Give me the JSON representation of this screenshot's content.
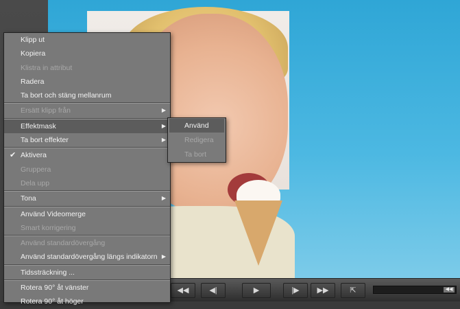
{
  "context_menu": {
    "items": [
      {
        "label": "Klipp ut",
        "enabled": true
      },
      {
        "label": "Kopiera",
        "enabled": true
      },
      {
        "label": "Klistra in attribut",
        "enabled": false
      },
      {
        "label": "Radera",
        "enabled": true
      },
      {
        "label": "Ta bort och stäng mellanrum",
        "enabled": true
      },
      {
        "label": "Ersätt klipp från",
        "enabled": false,
        "submenu": true
      },
      {
        "label": "Effektmask",
        "enabled": true,
        "submenu": true,
        "selected": true
      },
      {
        "label": "Ta bort effekter",
        "enabled": true,
        "submenu": true
      },
      {
        "label": "Aktivera",
        "enabled": true,
        "checked": true
      },
      {
        "label": "Gruppera",
        "enabled": false
      },
      {
        "label": "Dela upp",
        "enabled": false
      },
      {
        "label": "Tona",
        "enabled": true,
        "submenu": true
      },
      {
        "label": "Använd Videomerge",
        "enabled": true
      },
      {
        "label": "Smart korrigering",
        "enabled": false
      },
      {
        "label": "Använd standardövergång",
        "enabled": false
      },
      {
        "label": "Använd standardövergång längs indikatorn",
        "enabled": true,
        "submenu": true
      },
      {
        "label": "Tidssträckning ...",
        "enabled": true
      },
      {
        "label": "Rotera 90° åt vänster",
        "enabled": true
      },
      {
        "label": "Rotera 90° åt höger",
        "enabled": true
      }
    ],
    "arrow_glyph": "▶",
    "check_glyph": "✔"
  },
  "submenu": {
    "items": [
      {
        "label": "Använd",
        "enabled": true,
        "selected": true
      },
      {
        "label": "Redigera",
        "enabled": false
      },
      {
        "label": "Ta bort",
        "enabled": false
      }
    ]
  },
  "transport": {
    "rewind_glyph": "◀◀",
    "step_back_glyph": "◀|",
    "play_glyph": "▶",
    "step_fwd_glyph": "|▶",
    "fast_fwd_glyph": "▶▶",
    "export_glyph": "⇱",
    "scrub_thumb_glyph": "◀◀"
  },
  "colors": {
    "menu_bg": "#797979",
    "menu_highlight": "#5c5c5c",
    "sky": "#2fa6d6"
  }
}
